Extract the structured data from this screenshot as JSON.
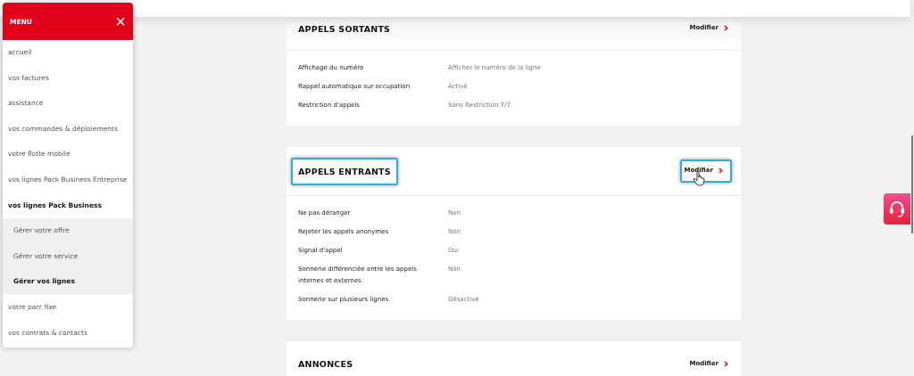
{
  "menu": {
    "title": "MENU",
    "close": "×",
    "items": [
      {
        "label": "accueil",
        "selected": false
      },
      {
        "label": "vos factures",
        "selected": false
      },
      {
        "label": "assistance",
        "selected": false
      },
      {
        "label": "vos commandes & déploiements",
        "selected": false
      },
      {
        "label": "votre flotte mobile",
        "selected": false
      },
      {
        "label": "vos lignes Pack Business Entreprise",
        "selected": false
      },
      {
        "label": "vos lignes Pack Business",
        "selected": true,
        "expanded": true,
        "children": [
          {
            "label": "Gérer votre offre",
            "selected": false
          },
          {
            "label": "Gérer votre service",
            "selected": false
          },
          {
            "label": "Gérer vos lignes",
            "selected": true
          }
        ]
      },
      {
        "label": "votre parc fixe",
        "selected": false
      },
      {
        "label": "vos contrats & contacts",
        "selected": false
      }
    ]
  },
  "sections": [
    {
      "title": "APPELS SORTANTS",
      "action": "Modifier",
      "highlighted": false,
      "rows": [
        {
          "label": "Affichage du numéro",
          "value": "Afficher le numéro de la ligne"
        },
        {
          "label": "Rappel automatique sur occupation",
          "value": "Activé"
        },
        {
          "label": "Restriction d'appels",
          "value": "Sans Restriction 7/7"
        }
      ]
    },
    {
      "title": "APPELS ENTRANTS",
      "action": "Modifier",
      "highlighted": true,
      "rows": [
        {
          "label": "Ne pas déranger",
          "value": "Non"
        },
        {
          "label": "Rejeter les appels anonymes",
          "value": "Non"
        },
        {
          "label": "Signal d'appel",
          "value": "Oui"
        },
        {
          "label": "Sonnerie différenciée entre les appels internes et externes",
          "value": "Non"
        },
        {
          "label": "Sonnerie sur plusieurs lignes",
          "value": "Désactivé"
        }
      ]
    },
    {
      "title": "ANNONCES",
      "action": "Modifier",
      "highlighted": false
    }
  ]
}
